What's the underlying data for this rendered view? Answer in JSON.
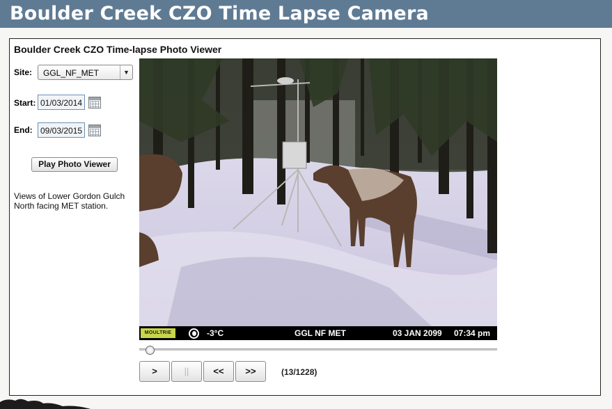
{
  "header": {
    "title": "Boulder Creek CZO Time Lapse Camera"
  },
  "viewer": {
    "title": "Boulder Creek CZO Time-lapse Photo Viewer",
    "site_label": "Site:",
    "site_value": "GGL_NF_MET",
    "start_label": "Start:",
    "start_value": "01/03/2014",
    "end_label": "End:",
    "end_value": "09/03/2015",
    "play_label": "Play Photo Viewer",
    "description": "Views of Lower Gordon Gulch North facing MET station.",
    "photo_stamp": {
      "brand": "MOULTRIE",
      "temperature": "-3°C",
      "station": "GGL NF MET",
      "date": "03 JAN 2099",
      "time": "07:34 pm"
    },
    "slider_fraction": 0.01,
    "controls": {
      "next_label": ">",
      "pause_label": "||",
      "rewind_label": "<<",
      "forward_label": ">>"
    },
    "counter": "(13/1228)"
  },
  "icons": {
    "dropdown": "chevron-down-icon",
    "calendar": "calendar-icon",
    "moon": "moon-phase-icon"
  },
  "colors": {
    "header_bg": "#5f7b94",
    "input_border": "#6b8fb3"
  }
}
